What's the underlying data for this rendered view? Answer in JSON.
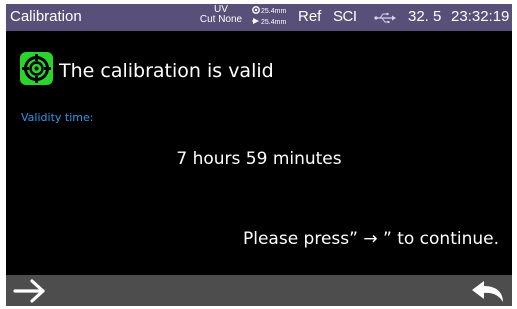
{
  "status_bar": {
    "title": "Calibration",
    "mode_line1": "UV",
    "mode_line2": "Cut None",
    "length_1": "25.4mm",
    "length_2": "25.4mm",
    "ref": "Ref",
    "sci": "SCI",
    "usb_icon": "usb-icon",
    "temperature": "32. 5",
    "time": "23:32:19"
  },
  "main": {
    "status_icon": "calibration-target-icon",
    "message": "The calibration is valid",
    "validity_label": "Validity time:",
    "validity_value": "7 hours 59 minutes",
    "instruction_text": "Please press” → ”  to continue."
  },
  "bottom_bar": {
    "next_icon": "arrow-right-icon",
    "back_icon": "return-arrow-icon"
  },
  "colors": {
    "status_bar_bg": "#59507a",
    "bottom_bar_bg": "#4d4d4d",
    "screen_bg": "#000000",
    "icon_green": "#2bd42b",
    "label_blue": "#2f97e8",
    "text": "#ffffff"
  }
}
